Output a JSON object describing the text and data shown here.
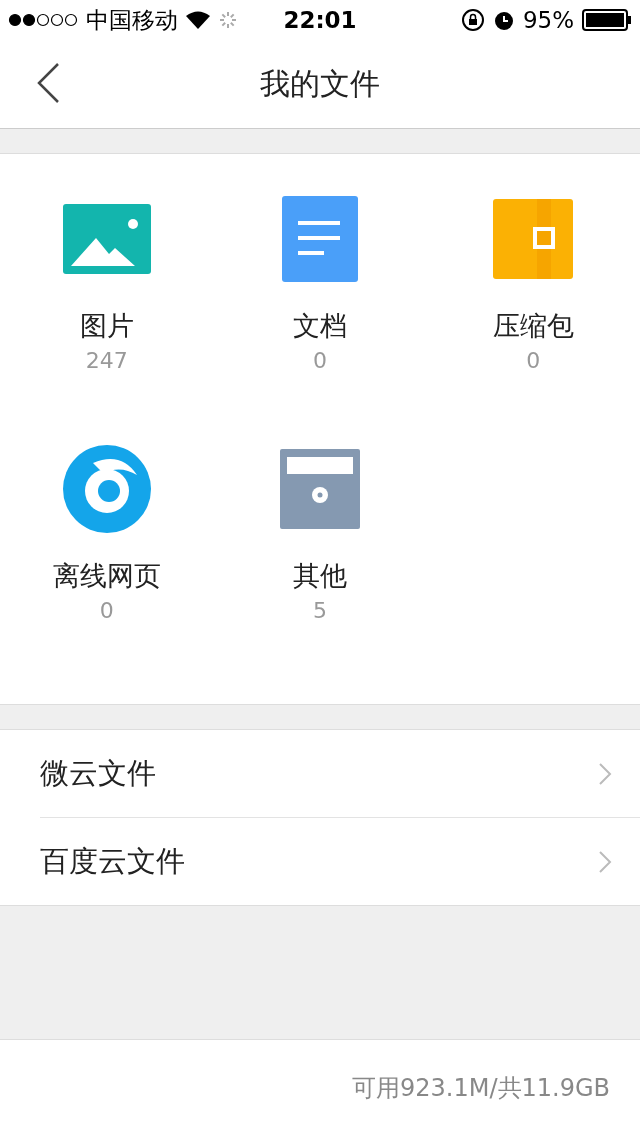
{
  "status_bar": {
    "carrier": "中国移动",
    "time": "22:01",
    "battery": "95%"
  },
  "nav": {
    "title": "我的文件"
  },
  "categories": [
    {
      "kind": "image",
      "label": "图片",
      "count": "247"
    },
    {
      "kind": "document",
      "label": "文档",
      "count": "0"
    },
    {
      "kind": "archive",
      "label": "压缩包",
      "count": "0"
    },
    {
      "kind": "webpage",
      "label": "离线网页",
      "count": "0"
    },
    {
      "kind": "other",
      "label": "其他",
      "count": "5"
    }
  ],
  "cloud_items": [
    {
      "label": "微云文件"
    },
    {
      "label": "百度云文件"
    }
  ],
  "footer": {
    "storage": "可用923.1M/共11.9GB"
  }
}
